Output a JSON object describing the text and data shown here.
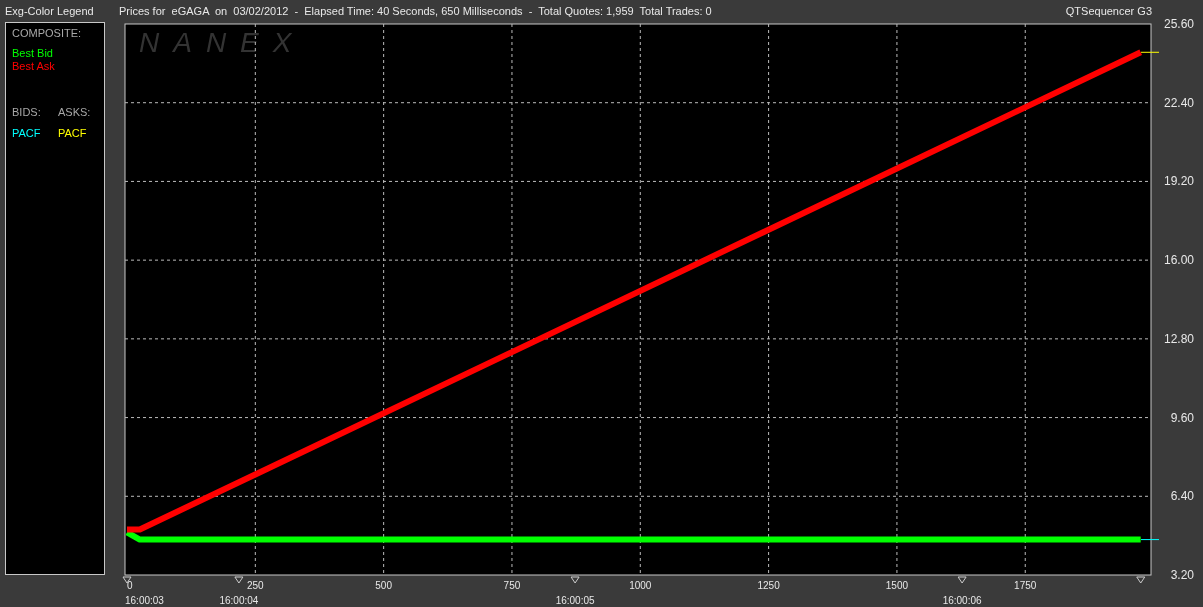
{
  "legend": {
    "title": "Exg-Color Legend",
    "section": "COMPOSITE:",
    "bids_heading": "BIDS:",
    "asks_heading": "ASKS:",
    "bids": [
      {
        "label": "PACF",
        "color": "#00ffff"
      }
    ],
    "asks": [
      {
        "label": "PACF",
        "color": "#ffff00"
      }
    ]
  },
  "app_name": "QTSequencer G3",
  "logo": "NANEX",
  "time_labels": [
    "16:00:03",
    "16:00:04",
    "16:00:05",
    "16:00:06"
  ],
  "chart_data": {
    "type": "line",
    "title": "Prices for  eGAGA  on  03/02/2012  -  Elapsed Time: 40 Seconds, 650 Milliseconds  -  Total Quotes: 1,959  Total Trades: 0",
    "x": [
      0,
      25,
      1975
    ],
    "series": [
      {
        "name": "Best Bid",
        "color": "#00ff00",
        "values": [
          4.93,
          4.64,
          4.64
        ]
      },
      {
        "name": "Best Ask",
        "color": "#ff0000",
        "values": [
          5.05,
          5.05,
          24.45
        ]
      }
    ],
    "xlim": [
      0,
      1995
    ],
    "ylim": [
      3.2,
      25.6
    ],
    "xticks": [
      0,
      250,
      500,
      750,
      1000,
      1250,
      1500,
      1750
    ],
    "yticks": [
      {
        "value": 3.2,
        "label": "3.20"
      },
      {
        "value": 6.4,
        "label": "6.40"
      },
      {
        "value": 9.6,
        "label": "9.60"
      },
      {
        "value": 12.8,
        "label": "12.80"
      },
      {
        "value": 16,
        "label": "16.00"
      },
      {
        "value": 19.2,
        "label": "19.20"
      },
      {
        "value": 22.4,
        "label": "22.40"
      },
      {
        "value": 25.6,
        "label": "25.60"
      }
    ],
    "grid": true
  }
}
